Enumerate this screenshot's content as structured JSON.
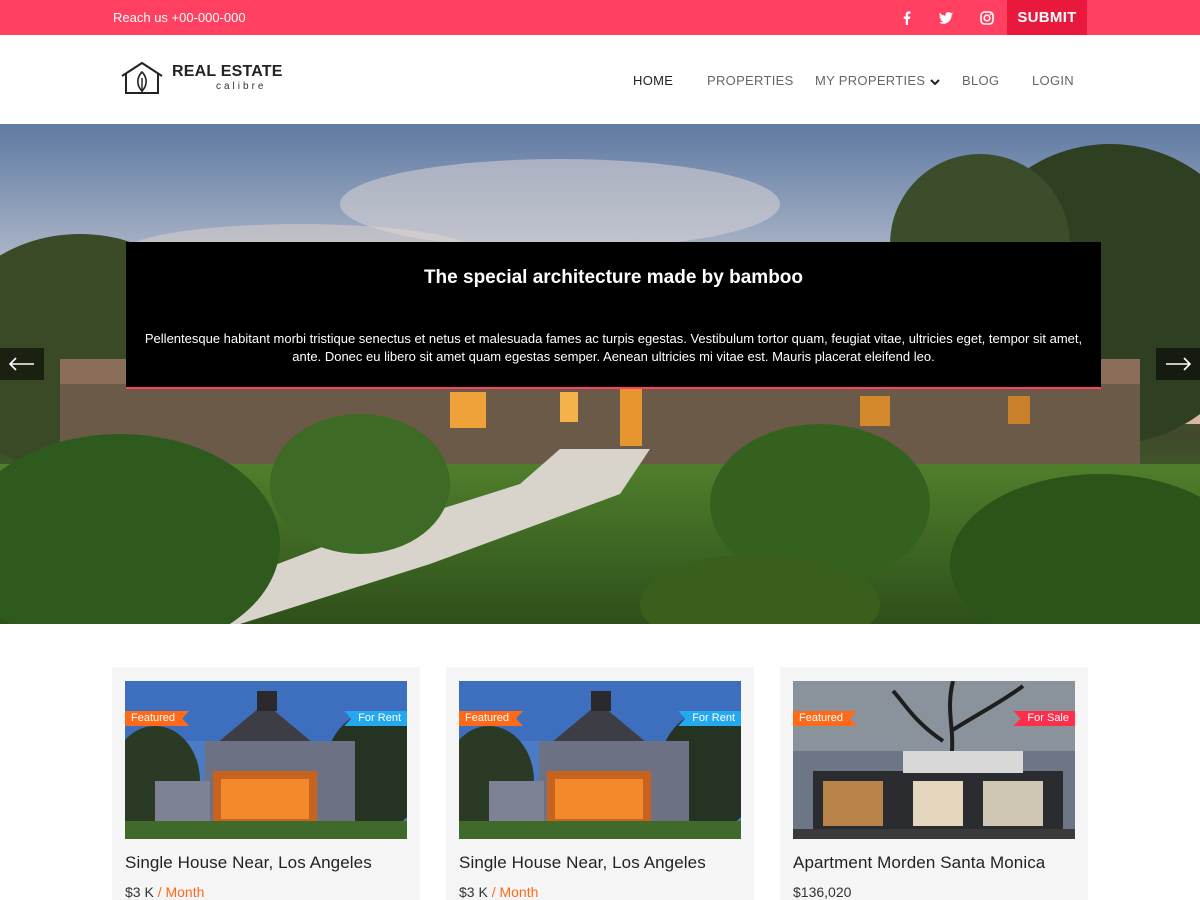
{
  "topbar": {
    "reach_text": "Reach us +00-000-000",
    "social": [
      "facebook-icon",
      "twitter-icon",
      "instagram-icon"
    ],
    "submit_label": "SUBMIT",
    "bar_color": "#ff4060",
    "submit_color": "#e8193c"
  },
  "logo": {
    "name": "REAL ESTATE",
    "tagline": "calibre"
  },
  "nav": {
    "items": [
      "HOME",
      "PROPERTIES",
      "MY PROPERTIES",
      "BLOG",
      "LOGIN"
    ],
    "active": "HOME"
  },
  "hero": {
    "title": "The special architecture made by bamboo",
    "description": "Pellentesque habitant morbi tristique senectus et netus et malesuada fames ac turpis egestas. Vestibulum tortor quam, feugiat vitae, ultricies eget, tempor sit amet, ante. Donec eu libero sit amet quam egestas semper. Aenean ultricies mi vitae est. Mauris placerat eleifend leo.",
    "prev_icon": "arrow-left-icon",
    "next_icon": "arrow-right-icon"
  },
  "listings": [
    {
      "featured_label": "Featured",
      "status_label": "For Rent",
      "title": "Single House Near, Los Angeles",
      "price": "$3 K",
      "period": " / Month"
    },
    {
      "featured_label": "Featured",
      "status_label": "For Rent",
      "title": "Single House Near, Los Angeles",
      "price": "$3 K",
      "period": " / Month"
    },
    {
      "featured_label": "Featured",
      "status_label": "For Sale",
      "title": "Apartment Morden Santa Monica",
      "price": "$136,020",
      "period": ""
    }
  ],
  "colors": {
    "featured": "#ff6a1a",
    "for_rent": "#24a8ef",
    "for_sale": "#ff2e4a"
  }
}
